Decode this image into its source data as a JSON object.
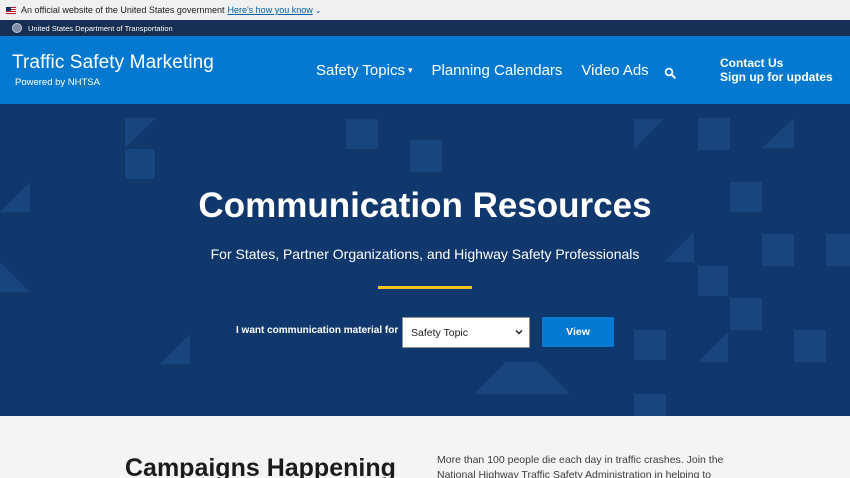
{
  "gov_banner": {
    "text": "An official website of the United States government",
    "link": "Here's how you know",
    "flag_icon": "us-flag-icon",
    "chevron_icon": "chevron-down-icon"
  },
  "agency_bar": {
    "text": "United States Department of Transportation",
    "seal_icon": "dot-seal-icon"
  },
  "header": {
    "title": "Traffic Safety Marketing",
    "subtitle": "Powered by NHTSA",
    "nav": [
      {
        "label": "Safety Topics",
        "has_dropdown": true
      },
      {
        "label": "Planning Calendars"
      },
      {
        "label": "Video Ads"
      }
    ],
    "search_icon": "search-icon",
    "contact": "Contact Us",
    "signup": "Sign up for updates"
  },
  "hero": {
    "title": "Communication Resources",
    "subtitle": "For States, Partner Organizations, and Highway Safety Professionals",
    "form_label": "I want communication material for",
    "select_value": "Safety Topic",
    "button": "View"
  },
  "campaigns": {
    "heading": "Campaigns Happening",
    "text": "More than 100 people die each day in traffic crashes. Join the National Highway Traffic Safety Administration in helping to"
  },
  "colors": {
    "header_blue": "#0579cf",
    "agency_bar": "#162e51",
    "hero_background": "#10386d",
    "accent_rule": "#f5c518"
  }
}
